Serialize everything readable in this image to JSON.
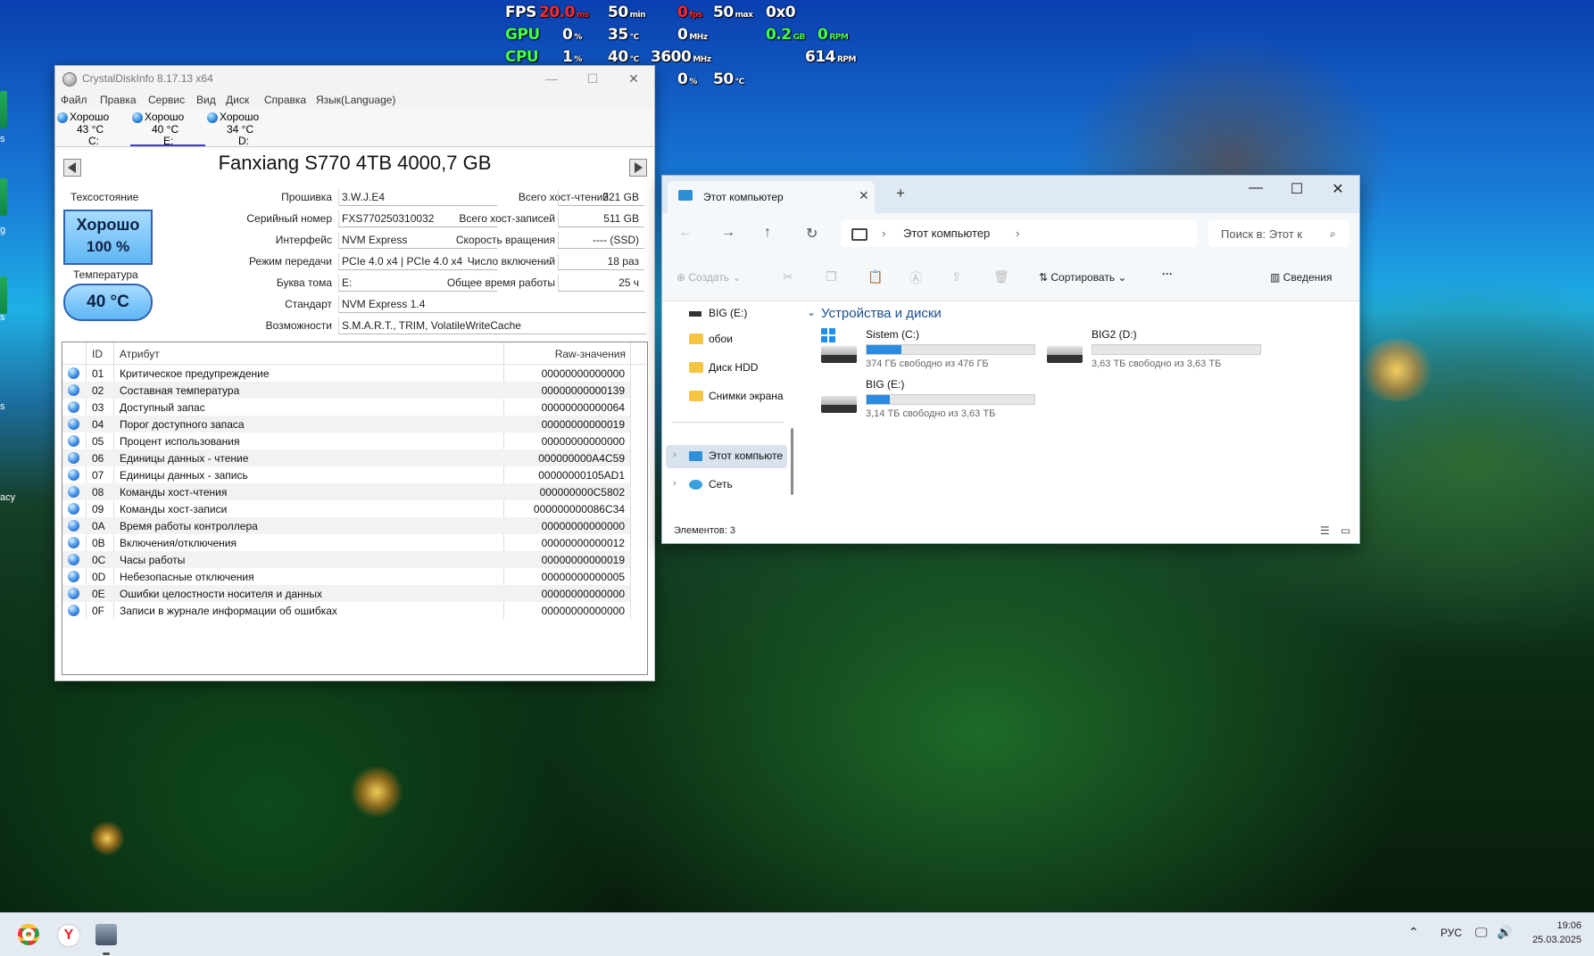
{
  "osd": {
    "row1": [
      {
        "text": "FPS",
        "unit": ""
      },
      {
        "text": "20.0",
        "unit": "ms"
      },
      {
        "text": "50",
        "unit": "min"
      },
      {
        "text": "0",
        "unit": "fps"
      },
      {
        "text": "50",
        "unit": "max"
      },
      {
        "text": "0x0",
        "unit": ""
      }
    ],
    "row2": [
      {
        "text": "GPU",
        "unit": ""
      },
      {
        "text": "0",
        "unit": "%"
      },
      {
        "text": "35",
        "unit": "°C"
      },
      {
        "text": "0",
        "unit": "MHz"
      },
      {
        "text": "0.2",
        "unit": "GB"
      },
      {
        "text": "0",
        "unit": "RPM"
      }
    ],
    "row3": [
      {
        "text": "CPU",
        "unit": ""
      },
      {
        "text": "1",
        "unit": "%"
      },
      {
        "text": "40",
        "unit": "°C"
      },
      {
        "text": "3600",
        "unit": "MHz"
      },
      {
        "text": "614",
        "unit": "RPM"
      }
    ],
    "row4": [
      {
        "text": "0",
        "unit": "%"
      },
      {
        "text": "50",
        "unit": "°C"
      }
    ]
  },
  "desktop": {
    "labels": [
      "s",
      "g",
      "s",
      "s",
      "acy"
    ]
  },
  "cdi": {
    "title": "CrystalDiskInfo 8.17.13 x64",
    "menu": [
      "Файл",
      "Правка",
      "Сервис",
      "Вид",
      "Диск",
      "Справка",
      "Язык(Language)"
    ],
    "drives": [
      {
        "status": "Хорошо",
        "temp": "43 °C",
        "letter": "C:"
      },
      {
        "status": "Хорошо",
        "temp": "40 °C",
        "letter": "E:"
      },
      {
        "status": "Хорошо",
        "temp": "34 °C",
        "letter": "D:"
      }
    ],
    "model": "Fanxiang S770 4TB 4000,7 GB",
    "health_label": "Техсостояние",
    "health_status": "Хорошо",
    "health_percent": "100 %",
    "temp_label": "Температура",
    "temp_value": "40 °C",
    "firmware_label": "Прошивка",
    "firmware": "3.W.J.E4",
    "serial_label": "Серийный номер",
    "serial": "FXS770250310032",
    "interface_label": "Интерфейс",
    "interface": "NVM Express",
    "transfer_label": "Режим передачи",
    "transfer": "PCIe 4.0 x4 | PCIe 4.0 x4",
    "volume_label": "Буква тома",
    "volume": "E:",
    "standard_label": "Стандарт",
    "standard": "NVM Express 1.4",
    "features_label": "Возможности",
    "features": "S.M.A.R.T., TRIM, VolatileWriteCache",
    "host_reads_label": "Всего хост-чтений",
    "host_reads": "321 GB",
    "host_writes_label": "Всего хост-записей",
    "host_writes": "511 GB",
    "rotation_label": "Скорость вращения",
    "rotation": "---- (SSD)",
    "power_count_label": "Число включений",
    "power_count": "18 раз",
    "power_hours_label": "Общее время работы",
    "power_hours": "25 ч",
    "table_headers": {
      "id": "ID",
      "attr": "Атрибут",
      "raw": "Raw-значения"
    },
    "attributes": [
      {
        "id": "01",
        "name": "Критическое предупреждение",
        "raw": "00000000000000"
      },
      {
        "id": "02",
        "name": "Составная температура",
        "raw": "00000000000139"
      },
      {
        "id": "03",
        "name": "Доступный запас",
        "raw": "00000000000064"
      },
      {
        "id": "04",
        "name": "Порог доступного запаса",
        "raw": "00000000000019"
      },
      {
        "id": "05",
        "name": "Процент использования",
        "raw": "00000000000000"
      },
      {
        "id": "06",
        "name": "Единицы данных - чтение",
        "raw": "000000000A4C59"
      },
      {
        "id": "07",
        "name": "Единицы данных - запись",
        "raw": "00000000105AD1"
      },
      {
        "id": "08",
        "name": "Команды хост-чтения",
        "raw": "000000000C5802"
      },
      {
        "id": "09",
        "name": "Команды хост-записи",
        "raw": "000000000086C34"
      },
      {
        "id": "0A",
        "name": "Время работы контроллера",
        "raw": "00000000000000"
      },
      {
        "id": "0B",
        "name": "Включения/отключения",
        "raw": "00000000000012"
      },
      {
        "id": "0C",
        "name": "Часы работы",
        "raw": "00000000000019"
      },
      {
        "id": "0D",
        "name": "Небезопасные отключения",
        "raw": "00000000000005"
      },
      {
        "id": "0E",
        "name": "Ошибки целостности носителя и данных",
        "raw": "00000000000000"
      },
      {
        "id": "0F",
        "name": "Записи в журнале информации об ошибках",
        "raw": "00000000000000"
      }
    ]
  },
  "explorer": {
    "tab_title": "Этот компьютер",
    "address": "Этот компьютер",
    "search_placeholder": "Поиск в: Этот к",
    "toolbar": {
      "create": "Создать",
      "sort": "Сортировать",
      "details": "Сведения"
    },
    "nav": [
      {
        "label": "BIG (E:)"
      },
      {
        "label": "обои"
      },
      {
        "label": "Диск HDD"
      },
      {
        "label": "Снимки экрана"
      },
      {
        "label": "Этот компьюте"
      },
      {
        "label": "Сеть"
      }
    ],
    "section": "Устройства и диски",
    "drives": [
      {
        "name": "Sistem (C:)",
        "free": "374 ГБ свободно из 476 ГБ",
        "used_fraction": 0.21
      },
      {
        "name": "BIG2 (D:)",
        "free": "3,63 ТБ свободно из 3,63 ТБ",
        "used_fraction": 0.0
      },
      {
        "name": "BIG (E:)",
        "free": "3,14 ТБ свободно из 3,63 ТБ",
        "used_fraction": 0.14
      }
    ],
    "status": "Элементов: 3"
  },
  "taskbar": {
    "lang": "РУС",
    "time": "19:06",
    "date": "25.03.2025"
  }
}
